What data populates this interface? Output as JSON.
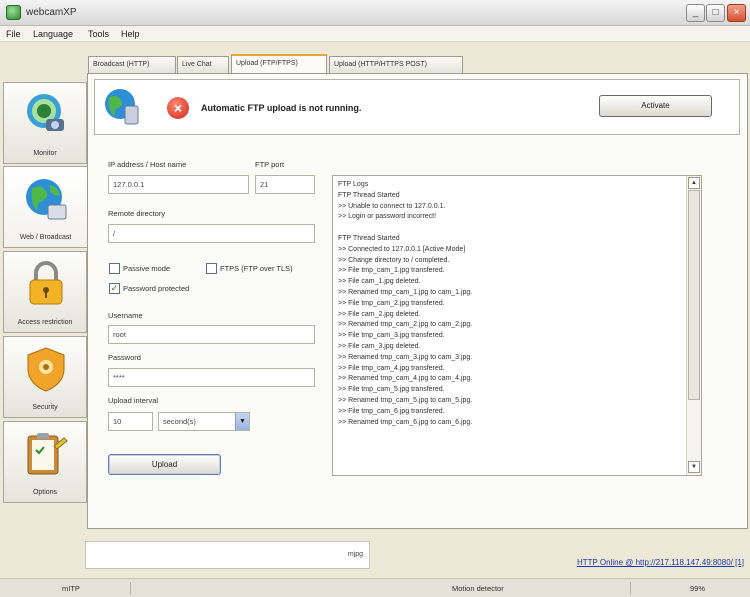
{
  "window": {
    "title": "webcamXP",
    "minimize": "_",
    "maximize": "□",
    "close": "×"
  },
  "menu": [
    "File",
    "Language",
    "Tools",
    "Help"
  ],
  "sidebar": [
    {
      "label": "Monitor",
      "icon": "monitor-camera-icon"
    },
    {
      "label": "Web / Broadcast",
      "icon": "globe-icon"
    },
    {
      "label": "Access restriction",
      "icon": "padlock-icon"
    },
    {
      "label": "Security",
      "icon": "shield-icon"
    },
    {
      "label": "Options",
      "icon": "clipboard-icon"
    }
  ],
  "tabs": [
    {
      "label": "Broadcast (HTTP)"
    },
    {
      "label": "Live Chat"
    },
    {
      "label": "Upload (FTP/FTPS)"
    },
    {
      "label": "Upload (HTTP/HTTPS POST)"
    }
  ],
  "active_tab_index": 2,
  "ftp_status": {
    "message": "Automatic FTP upload is not running.",
    "activate_label": "Activate"
  },
  "form": {
    "ip_label": "IP address / Host name",
    "ip_value": "127.0.0.1",
    "port_label": "FTP port",
    "port_value": "21",
    "remote_dir_label": "Remote directory",
    "remote_dir_value": "/",
    "passive_label": "Passive mode",
    "passive_checked": false,
    "ftps_label": "FTPS (FTP over TLS)",
    "ftps_checked": false,
    "password_protected_label": "Password protected",
    "password_protected_checked": true,
    "username_label": "Username",
    "username_value": "root",
    "password_label": "Password",
    "password_value": "****",
    "interval_label": "Upload interval",
    "interval_value": "10",
    "interval_unit": "second(s)",
    "upload_label": "Upload",
    "check_mark": "✓",
    "dropdown_arrow": "▼"
  },
  "log": {
    "lines": [
      "FTP Logs",
      "FTP Thread Started",
      ">> Unable to connect to 127.0.0.1.",
      ">> Login or password incorrect!",
      "",
      "FTP Thread Started",
      ">> Connected to 127.0.0.1 [Active Mode]",
      ">> Change directory to / completed.",
      ">> File tmp_cam_1.jpg transfered.",
      ">> File cam_1.jpg deleted.",
      ">> Renamed tmp_cam_1.jpg to cam_1.jpg.",
      ">> File tmp_cam_2.jpg transfered.",
      ">> File cam_2.jpg deleted.",
      ">> Renamed tmp_cam_2.jpg to cam_2.jpg.",
      ">> File tmp_cam_3.jpg transfered.",
      ">> File cam_3.jpg deleted.",
      ">> Renamed tmp_cam_3.jpg to cam_3.jpg.",
      ">> File tmp_cam_4.jpg transfered.",
      ">> Renamed tmp_cam_4.jpg to cam_4.jpg.",
      ">> File tmp_cam_5.jpg transfered.",
      ">> Renamed tmp_cam_5.jpg to cam_5.jpg.",
      ">> File tmp_cam_6.jpg transfered.",
      ">> Renamed tmp_cam_6.jpg to cam_6.jpg."
    ],
    "scroll_up": "▲",
    "scroll_down": "▼"
  },
  "bottom": {
    "input_text": "mjpg",
    "http_status": "HTTP Online @ http://217.118.147.49:8080/ [1]"
  },
  "statusbar": {
    "left": "mITP",
    "middle": "Motion detector",
    "right": "99%"
  }
}
